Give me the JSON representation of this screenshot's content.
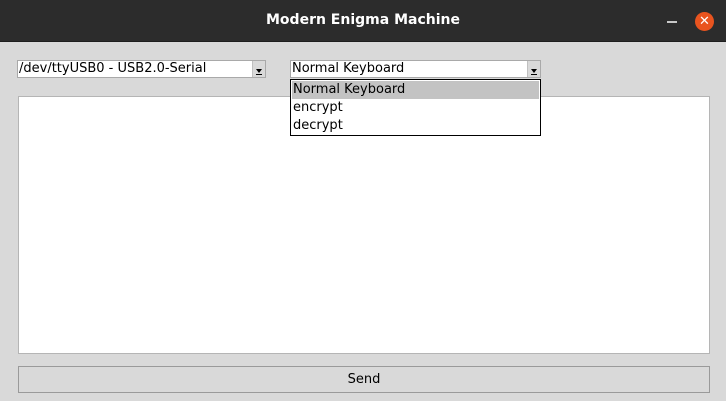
{
  "window": {
    "title": "Modern Enigma Machine",
    "close_glyph": "✕"
  },
  "port_select": {
    "value": "/dev/ttyUSB0 - USB2.0-Serial"
  },
  "mode_select": {
    "value": "Normal Keyboard",
    "options": [
      "Normal Keyboard",
      "encrypt",
      "decrypt"
    ],
    "highlighted_index": 0
  },
  "message_area": {
    "value": ""
  },
  "send_button": {
    "label": "Send"
  },
  "colors": {
    "titlebar": "#2c2c2c",
    "window_bg": "#d9d9d9",
    "close_button": "#e9541f",
    "option_highlight": "#c3c3c3"
  }
}
